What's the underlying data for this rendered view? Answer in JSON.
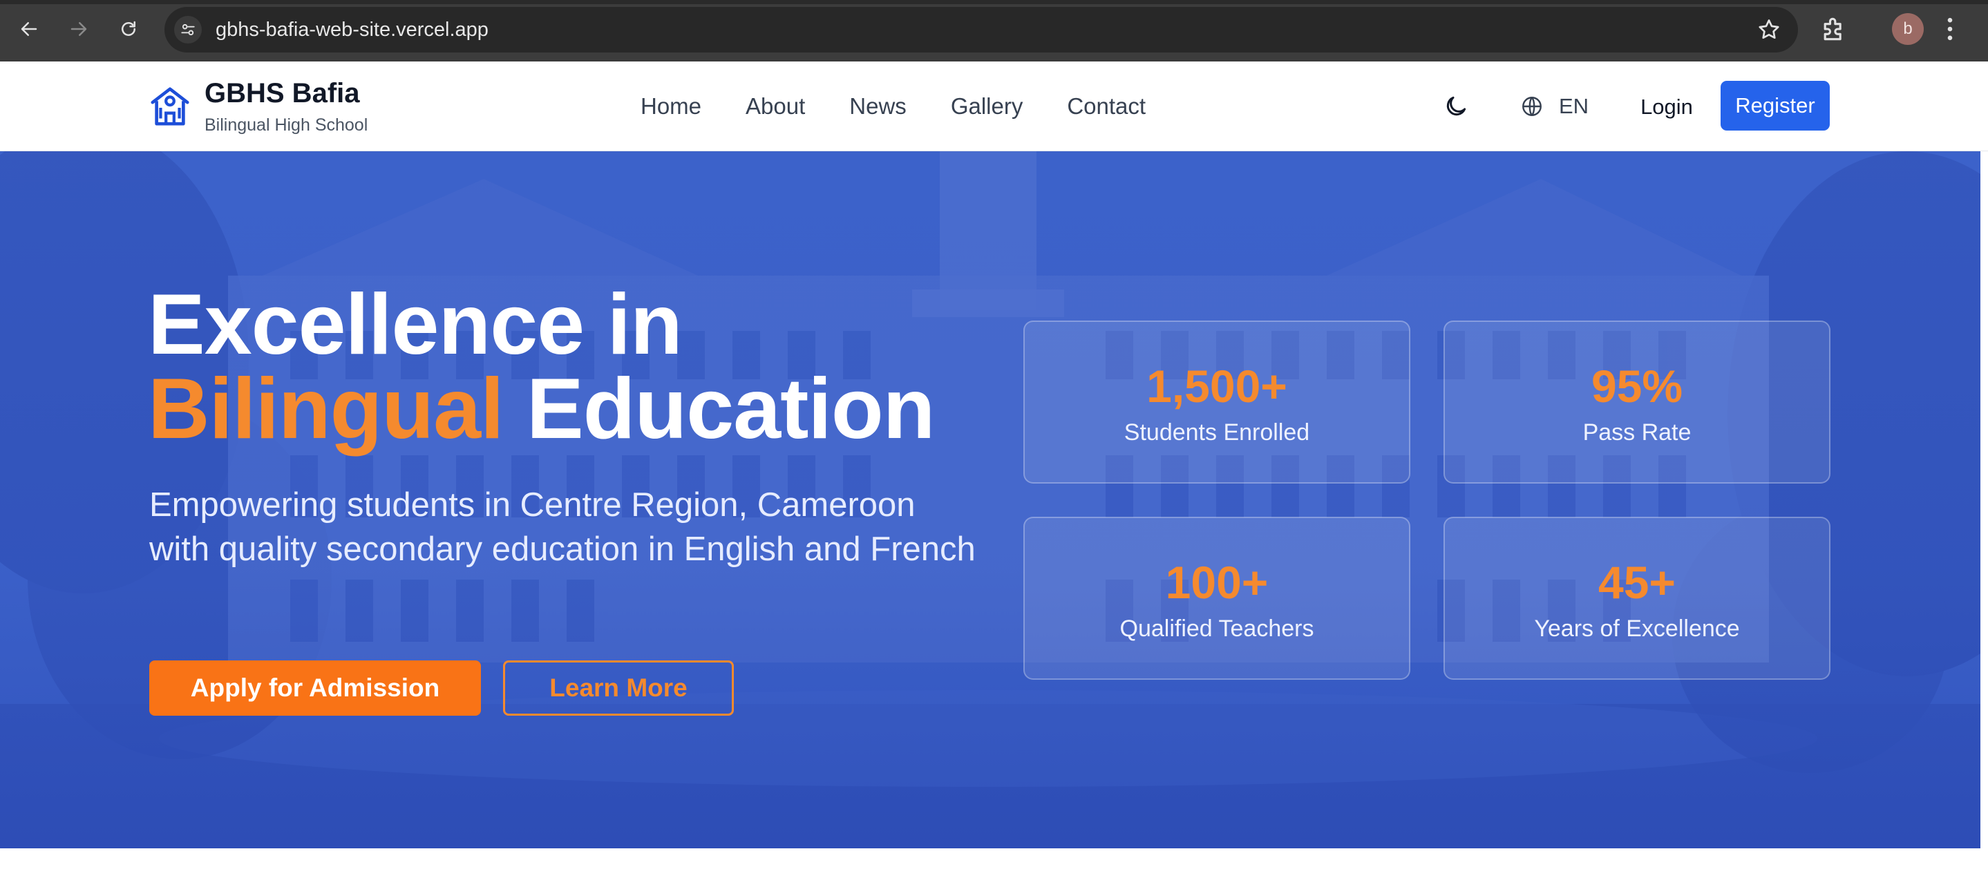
{
  "browser": {
    "url": "gbhs-bafia-web-site.vercel.app",
    "profile_initial": "b",
    "icons": [
      "back-icon",
      "forward-icon",
      "reload-icon",
      "site-settings-icon",
      "star-icon",
      "extensions-icon",
      "more-vert-icon"
    ]
  },
  "header": {
    "brand_name": "GBHS Bafia",
    "brand_tagline": "Bilingual High School",
    "nav": [
      "Home",
      "About",
      "News",
      "Gallery",
      "Contact"
    ],
    "language": "EN",
    "login_label": "Login",
    "register_label": "Register",
    "icons": [
      "school-icon",
      "moon-icon",
      "globe-icon"
    ]
  },
  "hero": {
    "title_line1": "Excellence in",
    "title_accent": "Bilingual",
    "title_rest": "Education",
    "subtitle": "Empowering students in Centre Region, Cameroon with quality secondary education in English and French",
    "apply_label": "Apply for Admission",
    "learn_label": "Learn More",
    "stats": [
      {
        "value": "1,500+",
        "label": "Students Enrolled"
      },
      {
        "value": "95%",
        "label": "Pass Rate"
      },
      {
        "value": "100+",
        "label": "Qualified Teachers"
      },
      {
        "value": "45+",
        "label": "Years of Excellence"
      }
    ]
  },
  "colors": {
    "primary_blue": "#2563eb",
    "accent_orange": "#f97316",
    "hero_overlay": "#3f64c8",
    "chrome_dark": "#3c3c3c"
  }
}
